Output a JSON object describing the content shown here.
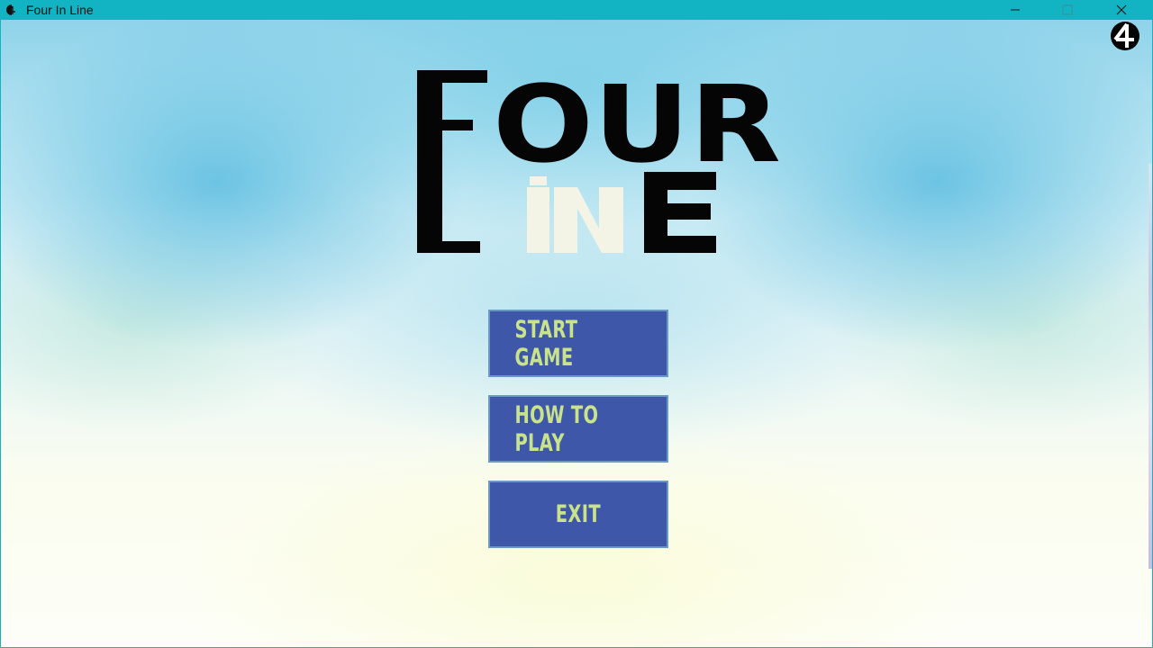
{
  "window": {
    "title": "Four In Line",
    "accent": "#12b4c3",
    "controls": {
      "minimize": "minimize-icon",
      "maximize": "maximize-icon",
      "close": "close-icon"
    }
  },
  "logo": {
    "line1": "FOUR",
    "line2": "LINE",
    "colors": {
      "ink": "#050505",
      "highlight": "#f3f3e6"
    }
  },
  "corner_badge": {
    "icon": "four-in-line-logo-icon"
  },
  "menu": {
    "buttons": [
      {
        "label": "START GAME"
      },
      {
        "label": "HOW TO PLAY"
      },
      {
        "label": "EXIT"
      }
    ],
    "button_bg": "#3f57a8",
    "button_text": "#c9e38a"
  }
}
